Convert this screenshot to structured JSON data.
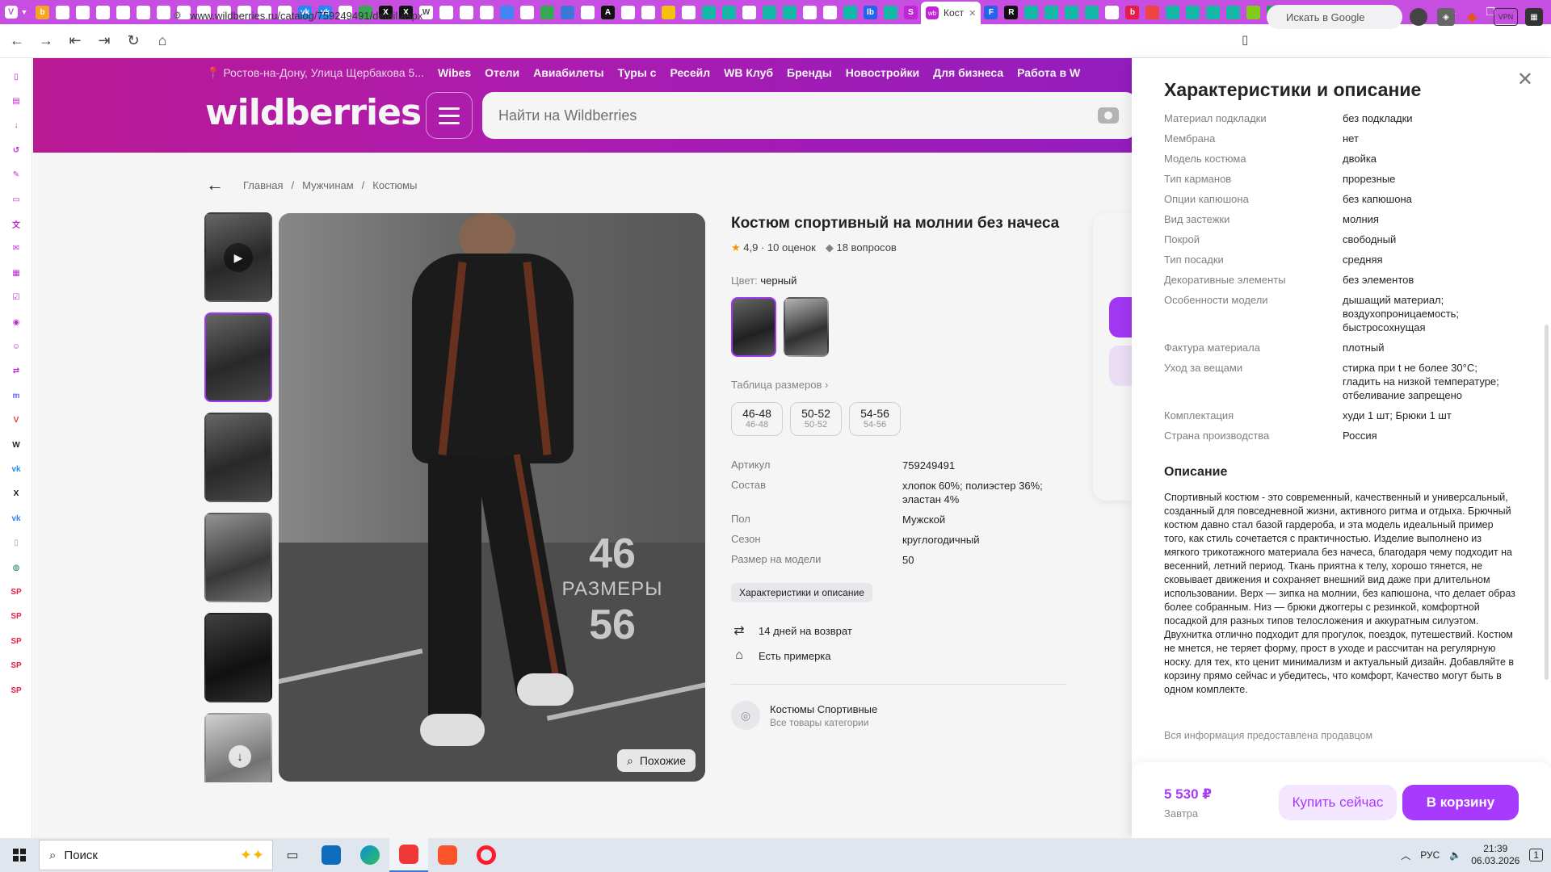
{
  "browser": {
    "active_tab_label": "Кост",
    "url": "www.wildberries.ru/catalog/759249491/detail.aspx",
    "search_placeholder": "Искать в Google",
    "vpn_label": "VPN",
    "tab_favicons": [
      {
        "name": "orange-circle-icon",
        "color": "#f7a525",
        "glyph": "b"
      },
      {
        "name": "page-icon",
        "color": "#ffffff",
        "glyph": ""
      },
      {
        "name": "page-icon",
        "color": "#ffffff",
        "glyph": ""
      },
      {
        "name": "page-icon",
        "color": "#ffffff",
        "glyph": ""
      },
      {
        "name": "page-icon",
        "color": "#ffffff",
        "glyph": ""
      },
      {
        "name": "page-icon",
        "color": "#ffffff",
        "glyph": ""
      },
      {
        "name": "page-icon",
        "color": "#ffffff",
        "glyph": ""
      },
      {
        "name": "page-icon",
        "color": "#ffffff",
        "glyph": ""
      },
      {
        "name": "page-icon",
        "color": "#ffffff",
        "glyph": ""
      },
      {
        "name": "page-icon",
        "color": "#ffffff",
        "glyph": ""
      },
      {
        "name": "page-icon",
        "color": "#ffffff",
        "glyph": ""
      },
      {
        "name": "page-icon",
        "color": "#ffffff",
        "glyph": ""
      },
      {
        "name": "page-icon",
        "color": "#ffffff",
        "glyph": ""
      },
      {
        "name": "vk-icon",
        "color": "#2787f5",
        "glyph": "vk"
      },
      {
        "name": "vk-icon",
        "color": "#2787f5",
        "glyph": "vk"
      },
      {
        "name": "page-icon",
        "color": "#ffffff",
        "glyph": ""
      },
      {
        "name": "green-square-icon",
        "color": "#3aa757",
        "glyph": ""
      },
      {
        "name": "x-icon",
        "color": "#111111",
        "glyph": "X"
      },
      {
        "name": "x-icon",
        "color": "#111111",
        "glyph": "X"
      },
      {
        "name": "wikipedia-icon",
        "color": "#ffffff",
        "glyph": "W"
      },
      {
        "name": "page-icon",
        "color": "#ffffff",
        "glyph": ""
      },
      {
        "name": "page-icon",
        "color": "#ffffff",
        "glyph": ""
      },
      {
        "name": "page-icon",
        "color": "#ffffff",
        "glyph": ""
      },
      {
        "name": "docs-icon",
        "color": "#4285f4",
        "glyph": ""
      },
      {
        "name": "page-icon",
        "color": "#ffffff",
        "glyph": ""
      },
      {
        "name": "colorful-icon",
        "color": "#34a853",
        "glyph": ""
      },
      {
        "name": "blue-arrow-icon",
        "color": "#3b78d8",
        "glyph": ""
      },
      {
        "name": "page-icon",
        "color": "#ffffff",
        "glyph": ""
      },
      {
        "name": "a-icon",
        "color": "#111111",
        "glyph": "A"
      },
      {
        "name": "page-icon",
        "color": "#ffffff",
        "glyph": ""
      },
      {
        "name": "page-icon",
        "color": "#ffffff",
        "glyph": ""
      },
      {
        "name": "yellow-icon",
        "color": "#f4c20d",
        "glyph": ""
      },
      {
        "name": "page-icon",
        "color": "#ffffff",
        "glyph": ""
      },
      {
        "name": "teal-icon",
        "color": "#14b8a6",
        "glyph": ""
      },
      {
        "name": "teal-icon",
        "color": "#14b8a6",
        "glyph": ""
      },
      {
        "name": "page-icon",
        "color": "#ffffff",
        "glyph": ""
      },
      {
        "name": "teal-icon",
        "color": "#14b8a6",
        "glyph": ""
      },
      {
        "name": "teal-icon",
        "color": "#14b8a6",
        "glyph": ""
      },
      {
        "name": "page-icon",
        "color": "#ffffff",
        "glyph": ""
      },
      {
        "name": "page-icon",
        "color": "#ffffff",
        "glyph": ""
      },
      {
        "name": "teal-icon",
        "color": "#14b8a6",
        "glyph": ""
      },
      {
        "name": "blue-lb-icon",
        "color": "#2563eb",
        "glyph": "lb"
      },
      {
        "name": "teal-icon",
        "color": "#14b8a6",
        "glyph": ""
      },
      {
        "name": "s-icon",
        "color": "#c026d3",
        "glyph": "S"
      }
    ],
    "tab_favicons_after": [
      {
        "name": "f-icon",
        "color": "#2563eb",
        "glyph": "F"
      },
      {
        "name": "r-icon",
        "color": "#111111",
        "glyph": "R"
      },
      {
        "name": "teal-icon",
        "color": "#14b8a6",
        "glyph": ""
      },
      {
        "name": "teal-icon",
        "color": "#14b8a6",
        "glyph": ""
      },
      {
        "name": "teal-icon",
        "color": "#14b8a6",
        "glyph": ""
      },
      {
        "name": "teal-icon",
        "color": "#14b8a6",
        "glyph": ""
      },
      {
        "name": "page-icon",
        "color": "#ffffff",
        "glyph": ""
      },
      {
        "name": "red-b-icon",
        "color": "#e11d48",
        "glyph": "b"
      },
      {
        "name": "red-square-icon",
        "color": "#ef4444",
        "glyph": ""
      },
      {
        "name": "teal-icon",
        "color": "#14b8a6",
        "glyph": ""
      },
      {
        "name": "teal-icon",
        "color": "#14b8a6",
        "glyph": ""
      },
      {
        "name": "teal-icon",
        "color": "#14b8a6",
        "glyph": ""
      },
      {
        "name": "teal-icon",
        "color": "#14b8a6",
        "glyph": ""
      },
      {
        "name": "colorful-icon",
        "color": "#84cc16",
        "glyph": ""
      },
      {
        "name": "ti-icon",
        "color": "#16a34a",
        "glyph": "TI"
      },
      {
        "name": "green-square-icon",
        "color": "#22c55e",
        "glyph": ""
      },
      {
        "name": "yellow-square-icon",
        "color": "#eab308",
        "glyph": ""
      },
      {
        "name": "blue-pen-icon",
        "color": "#3b82f6",
        "glyph": ""
      }
    ]
  },
  "sidepanel": {
    "icons": [
      {
        "name": "bookmarks-icon",
        "color": "#c026d3",
        "glyph": "▯"
      },
      {
        "name": "reader-icon",
        "color": "#c026d3",
        "glyph": "▤"
      },
      {
        "name": "downloads-icon",
        "color": "#c026d3",
        "glyph": "↓"
      },
      {
        "name": "history-icon",
        "color": "#c026d3",
        "glyph": "↺"
      },
      {
        "name": "notes-icon",
        "color": "#c026d3",
        "glyph": "✎"
      },
      {
        "name": "window-icon",
        "color": "#c026d3",
        "glyph": "▭"
      },
      {
        "name": "translate-icon",
        "color": "#c026d3",
        "glyph": "文"
      },
      {
        "name": "mail-icon",
        "color": "#c026d3",
        "glyph": "✉"
      },
      {
        "name": "calendar-icon",
        "color": "#c026d3",
        "glyph": "▦"
      },
      {
        "name": "tasks-icon",
        "color": "#c026d3",
        "glyph": "☑"
      },
      {
        "name": "feeds-icon",
        "color": "#c026d3",
        "glyph": "◉"
      },
      {
        "name": "contacts-icon",
        "color": "#c026d3",
        "glyph": "☺"
      },
      {
        "name": "sync-icon",
        "color": "#c026d3",
        "glyph": "⇄"
      },
      {
        "name": "mastodon-icon",
        "color": "#6364ff",
        "glyph": "m"
      },
      {
        "name": "vivaldi-icon",
        "color": "#ef3939",
        "glyph": "V"
      },
      {
        "name": "wikipedia-icon",
        "color": "#222222",
        "glyph": "W"
      },
      {
        "name": "vk-icon",
        "color": "#2787f5",
        "glyph": "vk"
      },
      {
        "name": "x-icon",
        "color": "#111111",
        "glyph": "X"
      },
      {
        "name": "vk-icon",
        "color": "#2787f5",
        "glyph": "vk"
      },
      {
        "name": "page-icon",
        "color": "#999999",
        "glyph": "▯"
      },
      {
        "name": "globe-icon",
        "color": "#0f766e",
        "glyph": "◍"
      },
      {
        "name": "sp-icon",
        "color": "#e11d48",
        "glyph": "SP"
      },
      {
        "name": "sp-icon",
        "color": "#e11d48",
        "glyph": "SP"
      },
      {
        "name": "sp-icon",
        "color": "#e11d48",
        "glyph": "SP"
      },
      {
        "name": "sp-icon",
        "color": "#e11d48",
        "glyph": "SP"
      },
      {
        "name": "sp-icon",
        "color": "#e11d48",
        "glyph": "SP"
      }
    ]
  },
  "header": {
    "location": "Ростов-на-Дону, Улица Щербакова 5...",
    "nav": [
      "Wibes",
      "Отели",
      "Авиабилеты",
      "Туры с",
      "Ресейл",
      "WB Клуб",
      "Бренды",
      "Новостройки",
      "Для бизнеса",
      "Работа в W"
    ],
    "logo": "wildberries",
    "search_placeholder": "Найти на Wildberries"
  },
  "breadcrumbs": [
    "Главная",
    "Мужчинам",
    "Костюмы"
  ],
  "product": {
    "title": "Костюм спортивный на молнии без начеса",
    "rating": "4,9",
    "reviews": "10 оценок",
    "questions": "18 вопросов",
    "color_label": "Цвет:",
    "color_value": "черный",
    "size_table_label": "Таблица размеров",
    "sizes": [
      {
        "label": "46-48",
        "sub": "46-48"
      },
      {
        "label": "50-52",
        "sub": "50-52"
      },
      {
        "label": "54-56",
        "sub": "54-56"
      }
    ],
    "specs": [
      {
        "k": "Артикул",
        "v": "759249491"
      },
      {
        "k": "Состав",
        "v": "хлопок 60%; полиэстер 36%; эластан 4%"
      },
      {
        "k": "Пол",
        "v": "Мужской"
      },
      {
        "k": "Сезон",
        "v": "круглогодичный"
      },
      {
        "k": "Размер на модели",
        "v": "50"
      }
    ],
    "chars_button": "Характеристики и описание",
    "return_label": "14 дней на возврат",
    "fitting_label": "Есть примерка",
    "category_title": "Костюмы Спортивные",
    "category_sub": "Все товары категории",
    "image_text": {
      "top": "46",
      "mid": "РАЗМЕРЫ",
      "bottom": "56"
    },
    "similar_button": "Похожие"
  },
  "drawer": {
    "title": "Характеристики и описание",
    "characteristics": [
      {
        "k": "Материал подкладки",
        "v": "без подкладки"
      },
      {
        "k": "Мембрана",
        "v": "нет"
      },
      {
        "k": "Модель костюма",
        "v": "двойка"
      },
      {
        "k": "Тип карманов",
        "v": "прорезные"
      },
      {
        "k": "Опции капюшона",
        "v": "без капюшона"
      },
      {
        "k": "Вид застежки",
        "v": "молния"
      },
      {
        "k": "Покрой",
        "v": "свободный"
      },
      {
        "k": "Тип посадки",
        "v": "средняя"
      },
      {
        "k": "Декоративные элементы",
        "v": "без элементов"
      },
      {
        "k": "Особенности модели",
        "v": "дышащий материал; воздухопроницаемость; быстросохнущая"
      },
      {
        "k": "Фактура материала",
        "v": "плотный"
      },
      {
        "k": "Уход за вещами",
        "v": "стирка при t не более 30°C; гладить на низкой температуре; отбеливание запрещено"
      },
      {
        "k": "Комплектация",
        "v": "худи 1 шт; Брюки 1 шт"
      },
      {
        "k": "Страна производства",
        "v": "Россия"
      }
    ],
    "description_heading": "Описание",
    "description": "Спортивный костюм - это современный, качественный и универсальный, созданный для повседневной жизни, активного ритма и отдыха. Брючный костюм давно стал базой гардероба, и эта модель идеальный пример того, как стиль сочетается с практичностью. Изделие выполнено из мягкого трикотажного материала без начеса, благодаря чему подходит на весенний, летний период. Ткань приятна к телу, хорошо тянется, не сковывает движения и сохраняет внешний вид даже при длительном использовании. Верх — зипка на молнии, без капюшона, что делает образ более собранным. Низ — брюки джоггеры с резинкой, комфортной посадкой для разных типов телосложения и аккуратным силуэтом. Двухнитка отлично подходит для прогулок, поездок, путешествий. Костюм не мнется, не теряет форму, прост в уходе и рассчитан на регулярную носку. для тех, кто ценит минимализм и актуальный дизайн. Добавляйте в корзину прямо сейчас и убедитесь, что комфорт, Качество могут быть в одном комплекте.",
    "seller_note": "Вся информация предоставлена продавцом",
    "price": "5 530 ₽",
    "delivery": "Завтра",
    "buy_now": "Купить сейчас",
    "to_cart": "В корзину"
  },
  "taskbar": {
    "search_label": "Поиск",
    "lang": "РУС",
    "time": "21:39",
    "date": "06.03.2026",
    "notif_count": "1"
  },
  "colors": {
    "accent": "#a73afd",
    "header_start": "#c21b9b",
    "header_end": "#9a1fc6",
    "tabstrip": "#c64ee0"
  }
}
